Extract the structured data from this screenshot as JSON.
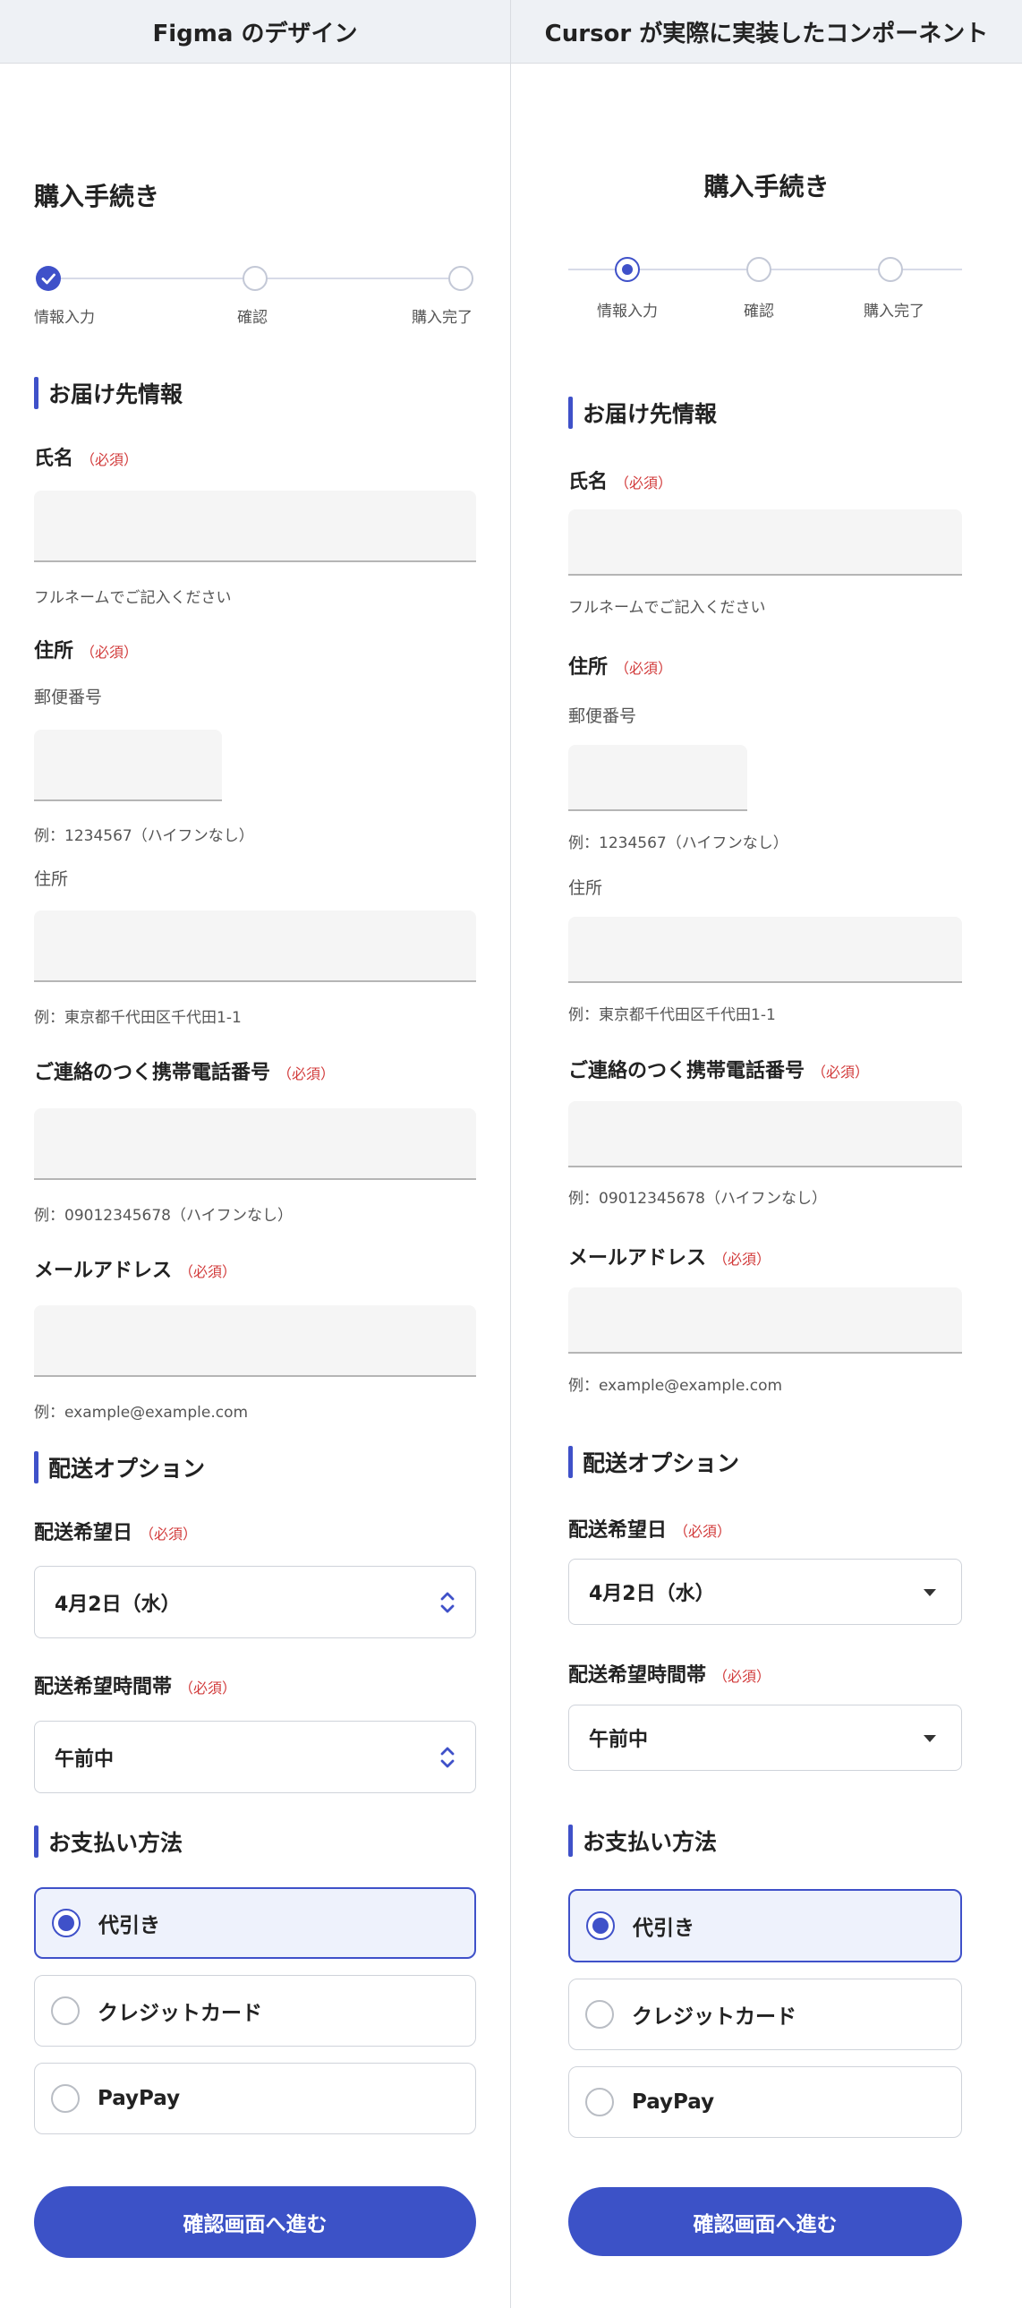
{
  "headers": {
    "left": "Figma のデザイン",
    "right": "Cursor が実際に実装したコンポーネント"
  },
  "form": {
    "title": "購入手続き",
    "steps": [
      "情報入力",
      "確認",
      "購入完了"
    ],
    "sections": {
      "delivery": "お届け先情報",
      "shipping": "配送オプション",
      "payment": "お支払い方法"
    },
    "required": "（必須）",
    "name": {
      "label": "氏名",
      "hint": "フルネームでご記入ください"
    },
    "address": {
      "label": "住所",
      "zip_label": "郵便番号",
      "zip_hint": "例：1234567（ハイフンなし）",
      "addr_label": "住所",
      "addr_hint": "例：東京都千代田区千代田1-1"
    },
    "phone": {
      "label": "ご連絡のつく携帯電話番号",
      "hint": "例：09012345678（ハイフンなし）"
    },
    "email": {
      "label": "メールアドレス",
      "hint": "例：example@example.com"
    },
    "date": {
      "label": "配送希望日",
      "value": "4月2日（水）"
    },
    "time": {
      "label": "配送希望時間帯",
      "value": "午前中"
    },
    "payment_options": [
      "代引き",
      "クレジットカード",
      "PayPay"
    ],
    "selected_payment": "代引き",
    "submit": "確認画面へ進む",
    "current_step": 1
  },
  "colors": {
    "accent": "#3f51c9",
    "required": "#d23b3b",
    "header_bg": "#eef1f5",
    "input_bg": "#f5f5f5"
  },
  "icons": {
    "left_select": "up-down-chevron-icon",
    "right_select": "caret-down-icon",
    "completed_step": "check-icon"
  }
}
